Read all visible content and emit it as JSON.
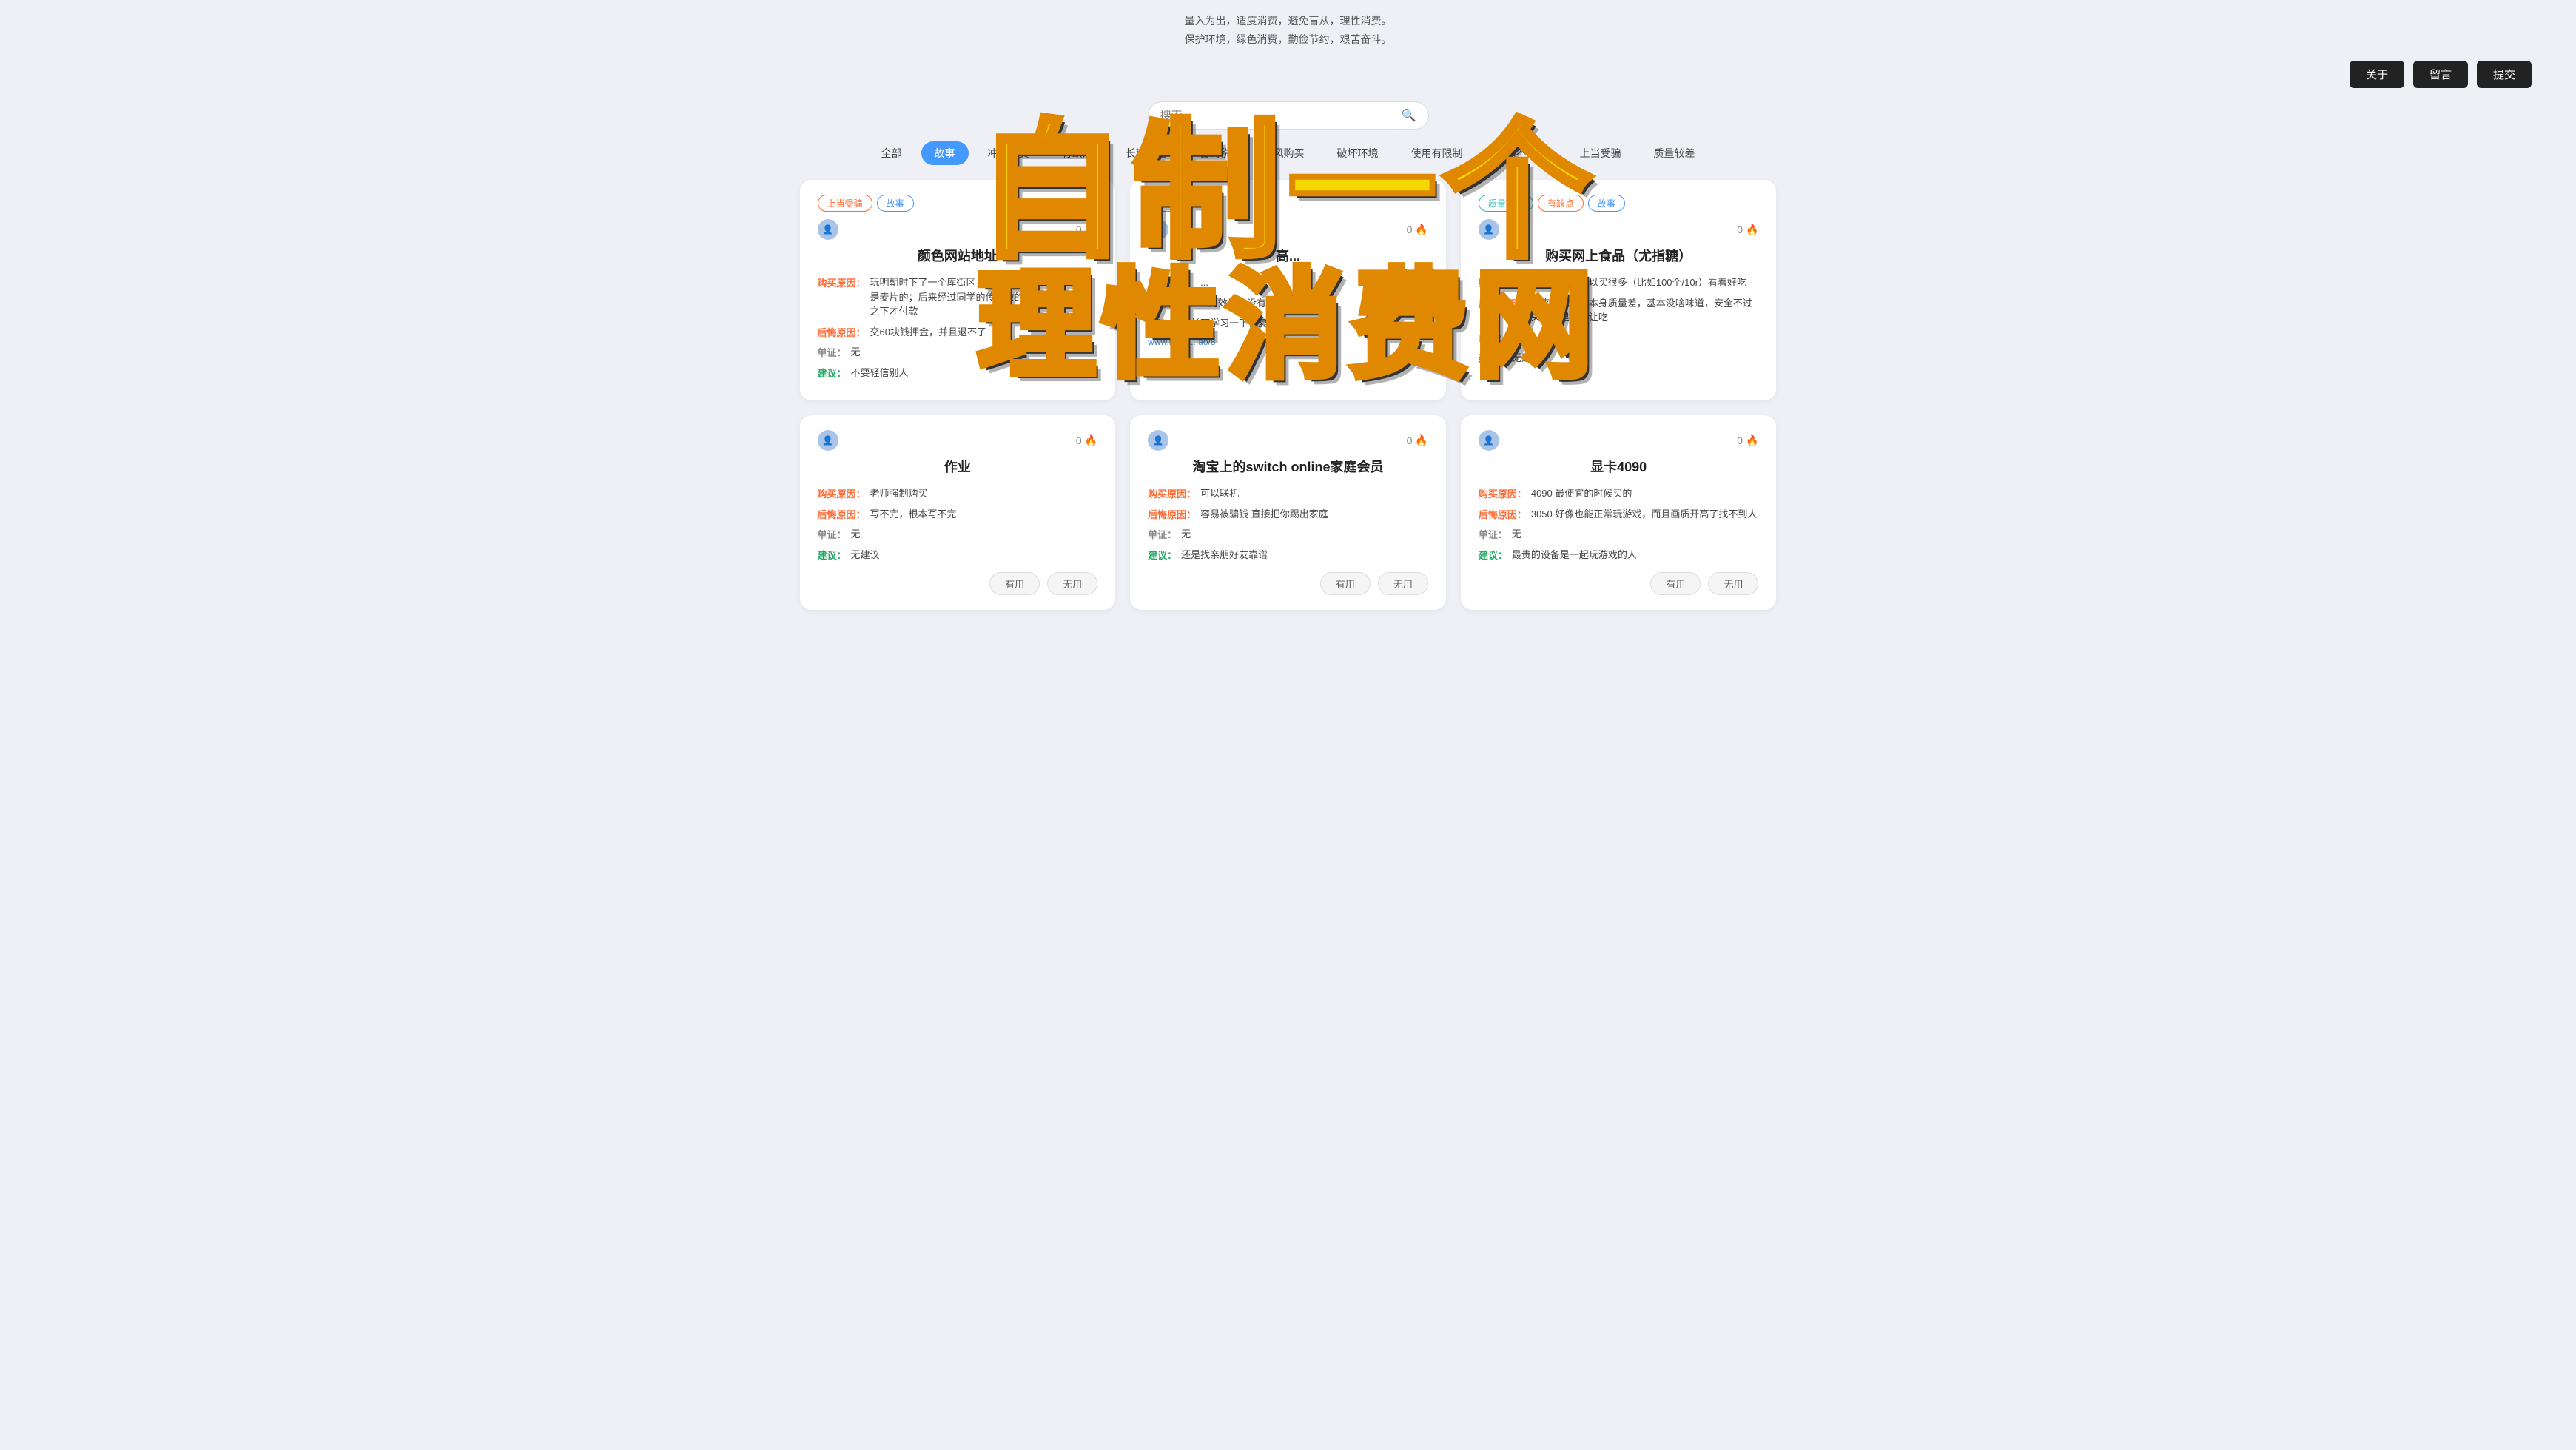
{
  "header": {
    "tagline_line1": "量入为出，适度消费，避免盲从，理性消费。",
    "tagline_line2": "保护环境，绿色消费，勤俭节约，艰苦奋斗。",
    "nav": {
      "about": "关于",
      "guestbook": "留言",
      "submit": "提交"
    }
  },
  "search": {
    "placeholder": "搜索"
  },
  "tabs": [
    {
      "id": "all",
      "label": "全部",
      "active": false
    },
    {
      "id": "story",
      "label": "故事",
      "active": true
    },
    {
      "id": "impulse",
      "label": "冲动消费",
      "active": false
    },
    {
      "id": "defect",
      "label": "有缺点",
      "active": false
    },
    {
      "id": "idle",
      "label": "长期闲置",
      "active": false
    },
    {
      "id": "tax",
      "label": "智商税",
      "active": false
    },
    {
      "id": "follow",
      "label": "跟风购买",
      "active": false
    },
    {
      "id": "env",
      "label": "破坏环境",
      "active": false
    },
    {
      "id": "limited",
      "label": "使用有限制",
      "active": false
    },
    {
      "id": "scam",
      "label": "需求不明确",
      "active": false
    },
    {
      "id": "tricked",
      "label": "上当受骗",
      "active": false
    },
    {
      "id": "quality",
      "label": "质量较差",
      "active": false
    }
  ],
  "cards": [
    {
      "id": "card1",
      "tags": [
        {
          "label": "上当受骗",
          "type": "red"
        },
        {
          "label": "故事",
          "type": "blue"
        }
      ],
      "fire_count": "0",
      "title": "颜色网站地址",
      "buy_reason": "玩明朝时下了一个库街区，里面有个qq群号，加了，是麦片的；后来经过同学的传图做的太好了，不得已之下才付款",
      "regret_reason": "交60块钱押金，并且退不了",
      "cert": "无",
      "advice": "不要轻信别人"
    },
    {
      "id": "card2",
      "tags": [
        {
          "label": "故事",
          "type": "blue"
        }
      ],
      "fire_count": "0",
      "title": "高...",
      "buy_reason": "...",
      "regret_reason": "...的效果也没有",
      "cert": "...",
      "advice": "家长可学习一下恢复默认系",
      "link": "www.bilibili...ao/8"
    },
    {
      "id": "card3",
      "tags": [
        {
          "label": "质量较差",
          "type": "teal"
        },
        {
          "label": "有缺点",
          "type": "red"
        },
        {
          "label": "故事",
          "type": "blue"
        }
      ],
      "fire_count": "0",
      "title": "购买网上食品（尤指糖）",
      "buy_reason": "用很少的钱可以买很多（比如100个/10r）看着好吃",
      "regret_reason": "后来发现东西本身质量差，基本没啥味道，安全不过关，家里人不让吃",
      "cert": "无",
      "advice": "无建议"
    },
    {
      "id": "card4",
      "tags": [],
      "fire_count": "0",
      "title": "作业",
      "buy_reason": "老师强制购买",
      "regret_reason": "写不完，根本写不完",
      "cert": "无",
      "advice": "无建议",
      "show_votes": true
    },
    {
      "id": "card5",
      "tags": [],
      "fire_count": "0",
      "title": "淘宝上的switch online家庭会员",
      "buy_reason": "可以联机",
      "regret_reason": "容易被骗钱 直接把你踢出家庭",
      "cert": "无",
      "advice": "还是找亲朋好友靠谱",
      "show_votes": true
    },
    {
      "id": "card6",
      "tags": [],
      "fire_count": "0",
      "title": "显卡4090",
      "buy_reason": "4090 最便宜的时候买的",
      "regret_reason": "3050 好像也能正常玩游戏，而且画质开高了找不到人",
      "cert": "无",
      "advice": "最贵的设备是一起玩游戏的人",
      "show_votes": true
    }
  ],
  "overlay": {
    "line1": "自制一个",
    "line2": "理性消费网"
  },
  "vote_buttons": {
    "useful": "有用",
    "useless": "无用"
  },
  "field_labels": {
    "buy": "购买原因：",
    "regret": "后悔原因：",
    "cert": "单证：",
    "advice": "建议："
  }
}
